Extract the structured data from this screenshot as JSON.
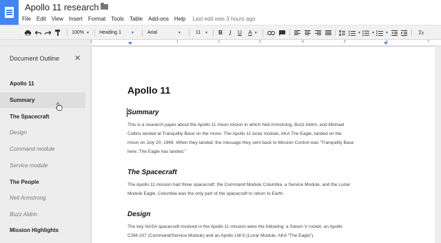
{
  "header": {
    "title": "Apollo 11 research",
    "menus": [
      "File",
      "Edit",
      "View",
      "Insert",
      "Format",
      "Tools",
      "Table",
      "Add-ons",
      "Help"
    ],
    "last_edit": "Last edit was 3 hours ago"
  },
  "toolbar": {
    "zoom": "100%",
    "style": "Heading 1",
    "font": "Arial",
    "size": "11",
    "bold": "B",
    "italic": "I",
    "underline": "U",
    "text_color": "A",
    "clear_format": "Tx"
  },
  "ruler": {
    "labels": [
      "1",
      "1",
      "2",
      "3",
      "4",
      "5",
      "6",
      "7"
    ]
  },
  "outline": {
    "title": "Document Outline",
    "items": [
      {
        "label": "Apollo 11",
        "level": "h1"
      },
      {
        "label": "Summary",
        "level": "h1"
      },
      {
        "label": "The Spacecraft",
        "level": "h1"
      },
      {
        "label": "Design",
        "level": "h3"
      },
      {
        "label": "Command module",
        "level": "h3"
      },
      {
        "label": "Service module",
        "level": "h3"
      },
      {
        "label": "The People",
        "level": "h1"
      },
      {
        "label": "Neil Armstrong",
        "level": "h3"
      },
      {
        "label": "Buzz Aldrin",
        "level": "h3"
      },
      {
        "label": "Mission Highlights",
        "level": "h1"
      }
    ],
    "active_index": 1
  },
  "document": {
    "title": "Apollo 11",
    "summary_heading": "Summary",
    "summary_lines": [
      "This is a research paper about the Apollo 11 moon mision in which Neil Armstrong, Buzz Aldrin, and Michael",
      "Collins landed at Tranquility Base on the moon. The Apollo 11 lunar module, AKA The Eagle, landed on the",
      "moon on July 20, 1969. When they landed, the message they sent back to Mission Control was “Tranquility Base",
      "here. The Eagle has landed.”"
    ],
    "spacecraft_heading": "The Spacecraft",
    "spacecraft_lines": [
      "The Apollo 11 mission had three spacecraft: the Command Module Columbia, a Service Module, and the Lunar",
      "Module Eagle. Columbia was the only part of the spacecraft to return to Earth."
    ],
    "design_heading": "Design",
    "design_lines": [
      "The key NASA spacecraft involved in the Apollo 11 mission were the following: a Saturn V rocket, an Apollo",
      "CSM-107 (Command/Service Module)  and an Apollo LM-5 (Lunar Module, AKA “The Eagle”)."
    ]
  },
  "colors": {
    "brand": "#4285f4",
    "page": "#ffffff",
    "canvas": "#ededed"
  }
}
